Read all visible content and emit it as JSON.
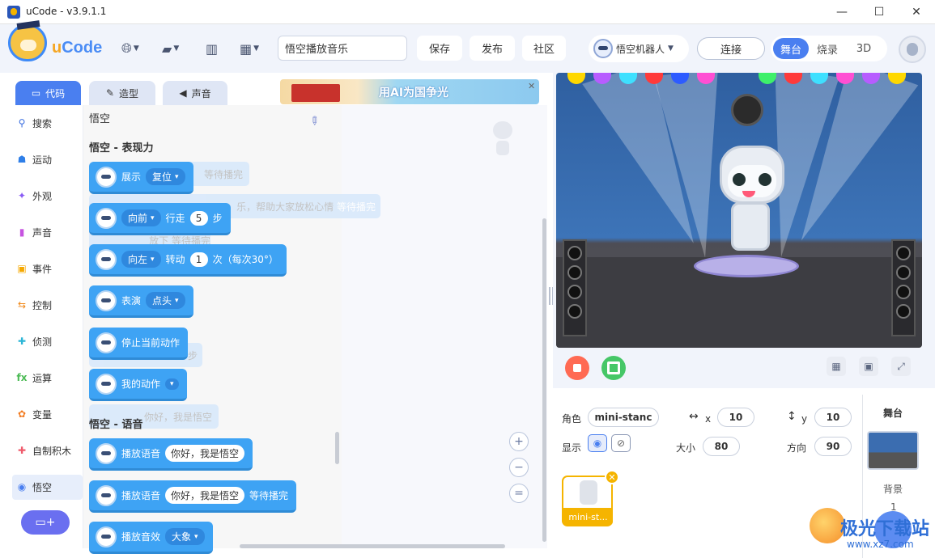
{
  "window": {
    "title": "uCode - v3.9.1.1",
    "minimize": "—",
    "maximize": "☐",
    "close": "✕"
  },
  "header": {
    "logo_u": "u",
    "logo_rest": "Code",
    "project_name": "悟空播放音乐",
    "save": "保存",
    "publish": "发布",
    "community": "社区",
    "device": "悟空机器人",
    "connect": "连接",
    "modes": [
      "舞台",
      "烧录",
      "3D"
    ]
  },
  "tabs": {
    "code": "代码",
    "costume": "造型",
    "sound": "声音"
  },
  "banner": {
    "text": "用AI为国争光"
  },
  "categories": [
    "搜索",
    "运动",
    "外观",
    "声音",
    "事件",
    "控制",
    "侦测",
    "运算",
    "变量",
    "自制积木",
    "悟空"
  ],
  "palette": {
    "title": "悟空",
    "section1": "悟空 - 表现力",
    "section2": "悟空 - 语音",
    "ghost_texts": [
      "等待播完",
      "乐，帮助大家放松心情",
      "等待播完",
      "放下",
      "等待播完",
      "你好，我是悟空",
      "你好，我是悟空",
      "停止当前动作",
      "步"
    ],
    "blocks": {
      "show": "展示",
      "show_opt": "复位",
      "move_dir": "向前",
      "move_walk": "行走",
      "move_steps": "5",
      "move_unit": "步",
      "turn_dir": "向左",
      "turn_label": "转动",
      "turn_times": "1",
      "turn_unit": "次（每次30°）",
      "perform": "表演",
      "perform_opt": "点头",
      "stop_action": "停止当前动作",
      "my_action": "我的动作",
      "play_voice": "播放语音",
      "voice_text": "你好，我是悟空",
      "play_voice2": "播放语音",
      "voice_text2": "你好，我是悟空",
      "wait_done": "等待播完",
      "play_effect": "播放音效",
      "effect_opt": "大象"
    }
  },
  "sprite": {
    "role_label": "角色",
    "role_name": "mini-stanc",
    "x_label": "x",
    "x": "10",
    "y_label": "y",
    "y": "10",
    "show_label": "显示",
    "size_label": "大小",
    "size": "80",
    "dir_label": "方向",
    "dir": "90",
    "card_name": "mini-st..."
  },
  "stage_col": {
    "title": "舞台",
    "bg_label": "背景",
    "bg_count": "1"
  },
  "watermark": {
    "text": "极光下载站",
    "url": "www.xz7.com"
  },
  "colors": {
    "accent": "#4a7ff0",
    "block": "#3ea3f4",
    "sprite_highlight": "#f5b400"
  }
}
